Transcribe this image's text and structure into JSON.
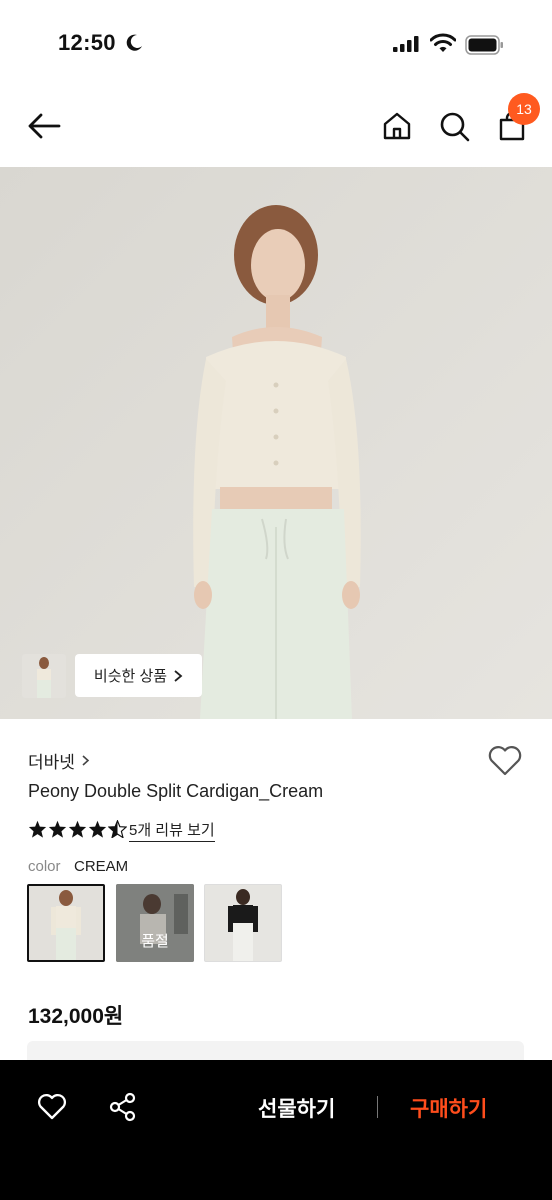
{
  "status": {
    "time": "12:50"
  },
  "header": {
    "cart_count": "13"
  },
  "hero": {
    "similar_label": "비슷한 상품"
  },
  "product": {
    "brand": "더바넷",
    "name": "Peony Double Split Cardigan_Cream",
    "rating_stars": 4.5,
    "review_link": "5개 리뷰 보기",
    "color_label": "color",
    "color_value": "CREAM",
    "swatches": [
      {
        "state": "selected"
      },
      {
        "badge": "품절"
      },
      {
        "state": "available"
      }
    ],
    "price": "132,000원"
  },
  "bottom_bar": {
    "gift_label": "선물하기",
    "buy_label": "구매하기"
  },
  "colors": {
    "accent": "#ff5a1f",
    "buy": "#ff4d1c",
    "bar": "#000000"
  }
}
